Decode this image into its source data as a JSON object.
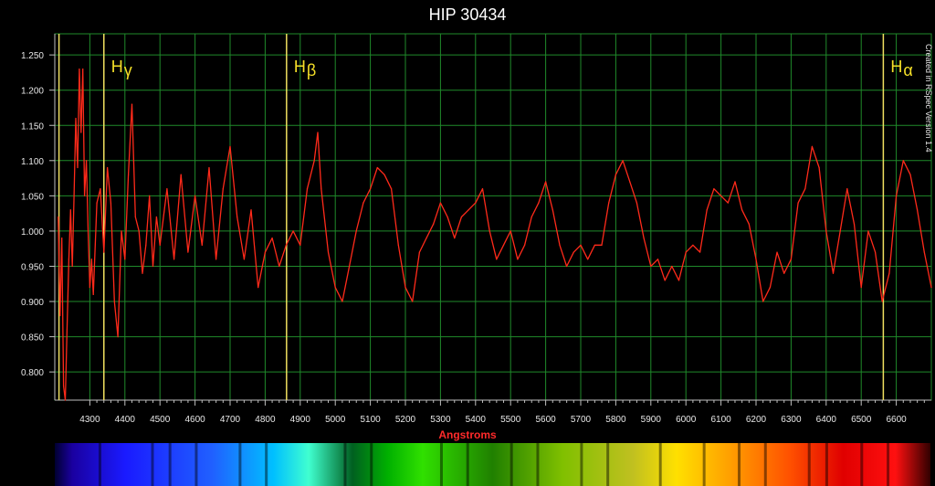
{
  "chart_data": {
    "type": "line",
    "title": "HIP 30434",
    "xlabel": "Angstroms",
    "ylabel": "",
    "xlim": [
      4200,
      6700
    ],
    "ylim": [
      0.76,
      1.28
    ],
    "x_ticks": [
      4300,
      4400,
      4500,
      4600,
      4700,
      4800,
      4900,
      5000,
      5100,
      5200,
      5300,
      5400,
      5500,
      5600,
      5700,
      5800,
      5900,
      6000,
      6100,
      6200,
      6300,
      6400,
      6500,
      6600
    ],
    "y_ticks": [
      0.8,
      0.85,
      0.9,
      0.95,
      1.0,
      1.05,
      1.1,
      1.15,
      1.2,
      1.25
    ],
    "y_tick_labels": [
      "0.800",
      "0.850",
      "0.900",
      "0.950",
      "1.000",
      "1.050",
      "1.100",
      "1.150",
      "1.200",
      "1.250"
    ],
    "grid": true,
    "series": [
      {
        "color": "#ff2a1a",
        "x": [
          4210,
          4215,
          4220,
          4225,
          4230,
          4235,
          4240,
          4245,
          4250,
          4255,
          4260,
          4265,
          4270,
          4275,
          4280,
          4285,
          4290,
          4295,
          4300,
          4305,
          4310,
          4320,
          4330,
          4340,
          4350,
          4360,
          4370,
          4380,
          4390,
          4400,
          4410,
          4420,
          4430,
          4440,
          4450,
          4460,
          4470,
          4480,
          4490,
          4500,
          4520,
          4540,
          4560,
          4580,
          4600,
          4620,
          4640,
          4660,
          4680,
          4700,
          4720,
          4740,
          4760,
          4780,
          4800,
          4820,
          4840,
          4860,
          4880,
          4900,
          4920,
          4940,
          4950,
          4960,
          4980,
          5000,
          5020,
          5040,
          5060,
          5080,
          5100,
          5120,
          5140,
          5160,
          5180,
          5200,
          5220,
          5240,
          5260,
          5280,
          5300,
          5320,
          5340,
          5360,
          5380,
          5400,
          5420,
          5440,
          5460,
          5480,
          5500,
          5520,
          5540,
          5560,
          5580,
          5600,
          5620,
          5640,
          5660,
          5680,
          5700,
          5720,
          5740,
          5760,
          5780,
          5800,
          5820,
          5840,
          5860,
          5880,
          5900,
          5920,
          5940,
          5960,
          5980,
          6000,
          6020,
          6040,
          6060,
          6080,
          6100,
          6120,
          6140,
          6160,
          6180,
          6200,
          6220,
          6240,
          6260,
          6280,
          6300,
          6320,
          6340,
          6360,
          6380,
          6400,
          6420,
          6440,
          6460,
          6480,
          6500,
          6520,
          6540,
          6560,
          6580,
          6600,
          6620,
          6640,
          6660,
          6680,
          6700
        ],
        "y": [
          1.02,
          0.88,
          0.99,
          0.78,
          0.76,
          0.86,
          0.96,
          1.03,
          0.95,
          1.05,
          1.16,
          1.09,
          1.23,
          1.14,
          1.23,
          1.05,
          1.1,
          1.0,
          0.92,
          0.96,
          0.91,
          1.04,
          1.06,
          0.97,
          1.09,
          1.04,
          0.9,
          0.85,
          1.0,
          0.96,
          1.08,
          1.18,
          1.02,
          1.0,
          0.94,
          0.98,
          1.05,
          0.95,
          1.02,
          0.98,
          1.06,
          0.96,
          1.08,
          0.97,
          1.05,
          0.98,
          1.09,
          0.96,
          1.06,
          1.12,
          1.02,
          0.96,
          1.03,
          0.92,
          0.97,
          0.99,
          0.95,
          0.98,
          1.0,
          0.98,
          1.06,
          1.1,
          1.14,
          1.06,
          0.97,
          0.92,
          0.9,
          0.95,
          1.0,
          1.04,
          1.06,
          1.09,
          1.08,
          1.06,
          0.98,
          0.92,
          0.9,
          0.97,
          0.99,
          1.01,
          1.04,
          1.02,
          0.99,
          1.02,
          1.03,
          1.04,
          1.06,
          1.0,
          0.96,
          0.98,
          1.0,
          0.96,
          0.98,
          1.02,
          1.04,
          1.07,
          1.03,
          0.98,
          0.95,
          0.97,
          0.98,
          0.96,
          0.98,
          0.98,
          1.04,
          1.08,
          1.1,
          1.07,
          1.04,
          0.99,
          0.95,
          0.96,
          0.93,
          0.95,
          0.93,
          0.97,
          0.98,
          0.97,
          1.03,
          1.06,
          1.05,
          1.04,
          1.07,
          1.03,
          1.01,
          0.96,
          0.9,
          0.92,
          0.97,
          0.94,
          0.96,
          1.04,
          1.06,
          1.12,
          1.09,
          1.0,
          0.94,
          1.0,
          1.06,
          1.01,
          0.92,
          1.0,
          0.97,
          0.9,
          0.94,
          1.05,
          1.1,
          1.08,
          1.03,
          0.97,
          0.92
        ]
      }
    ],
    "annotations": [
      {
        "label_main": "H",
        "label_sub": "γ",
        "x": 4340
      },
      {
        "label_main": "H",
        "label_sub": "β",
        "x": 4861
      },
      {
        "label_main": "H",
        "label_sub": "α",
        "x": 6563
      }
    ],
    "extra_marker_x": 4212
  },
  "watermark": "Created in RSpec Version 1.4",
  "colors": {
    "background": "#000000",
    "plot_background": "#000000",
    "grid": "#1f8a2a",
    "axis": "#bfbfbf",
    "series": "#ff2a1a",
    "marker_line": "#f0e060",
    "marker_text": "#f5e028",
    "title": "#ffffff",
    "xlabel": "#ff2a2a",
    "tick_text": "#e8e8e8"
  }
}
